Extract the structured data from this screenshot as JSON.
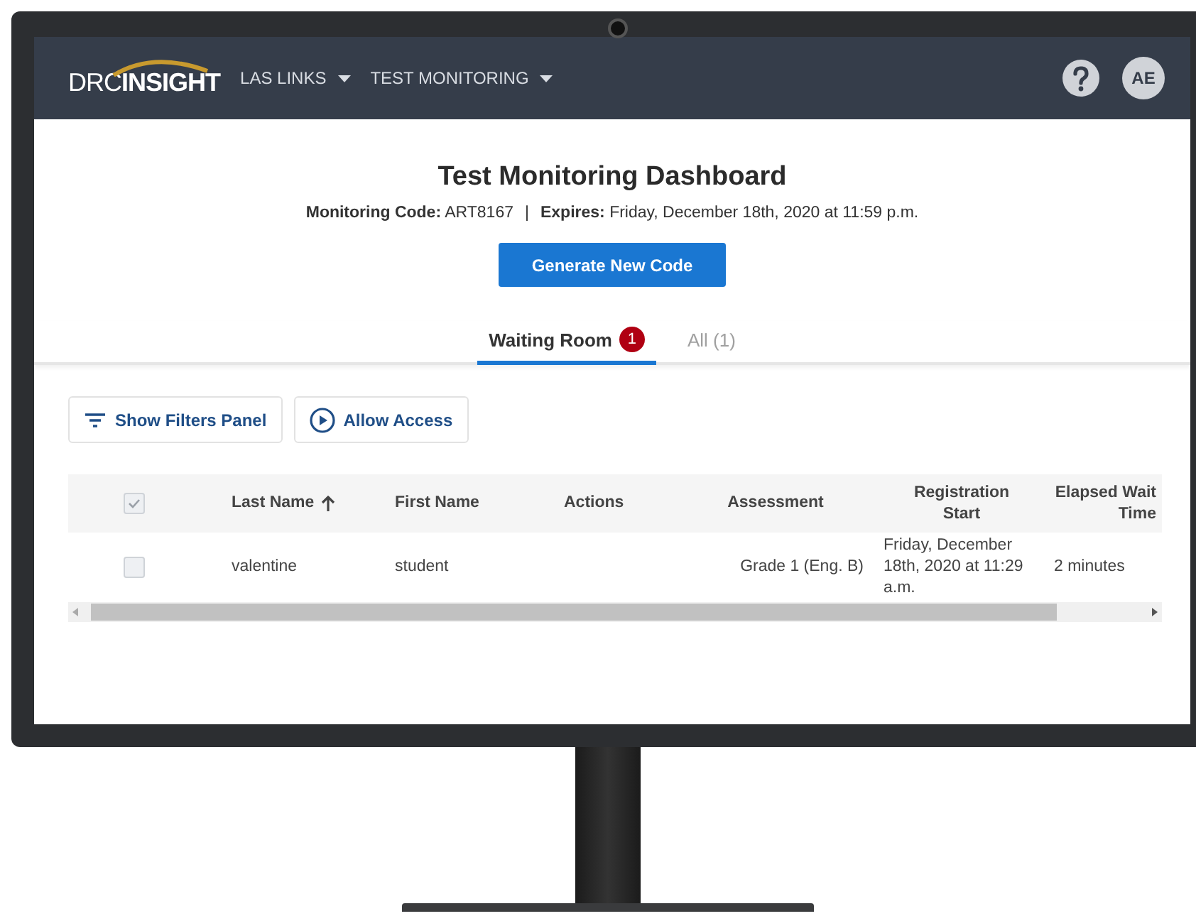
{
  "header": {
    "logo": {
      "word_1": "DRC",
      "word_2": "INSIGHT"
    },
    "menus": [
      {
        "label": "LAS LINKS"
      },
      {
        "label": "TEST MONITORING"
      }
    ],
    "avatar": "AE"
  },
  "dashboard": {
    "title": "Test Monitoring Dashboard",
    "code_line": "**Monitoring Code:** ART8167",
    "separator": "|",
    "expires_line": "**Expires:** Friday, December 18th, 2020 at 11:59 p.m.",
    "generate_button": "Generate New Code"
  },
  "tabs": [
    {
      "label": "Waiting Room",
      "badge": "1",
      "selected": true
    },
    {
      "label": "All (1)",
      "selected": false
    }
  ],
  "toolbar": [
    {
      "label": "Show Filters Panel",
      "kind": "filter"
    },
    {
      "label": "Allow Access",
      "kind": "play"
    }
  ],
  "table": {
    "select_all": {
      "checked": true
    },
    "columns": [
      {
        "label": "Last Name",
        "sorted": true
      },
      {
        "label": "First Name",
        "sorted": false
      },
      {
        "label": "Actions",
        "sorted": false
      },
      {
        "label": "Assessment",
        "sorted": false
      },
      {
        "label": "Registration Start",
        "sorted": false
      },
      {
        "label": "Elapsed Wait Time",
        "sorted": false
      }
    ],
    "rows": [
      {
        "checked": false,
        "last_name": "valentine",
        "first_name": "student",
        "assessment": "Grade 1 (Eng. B)",
        "registration_start": "Friday, December 18th, 2020 at 11:29 a.m.",
        "elapsed_wait_time": "2 minutes"
      }
    ]
  }
}
